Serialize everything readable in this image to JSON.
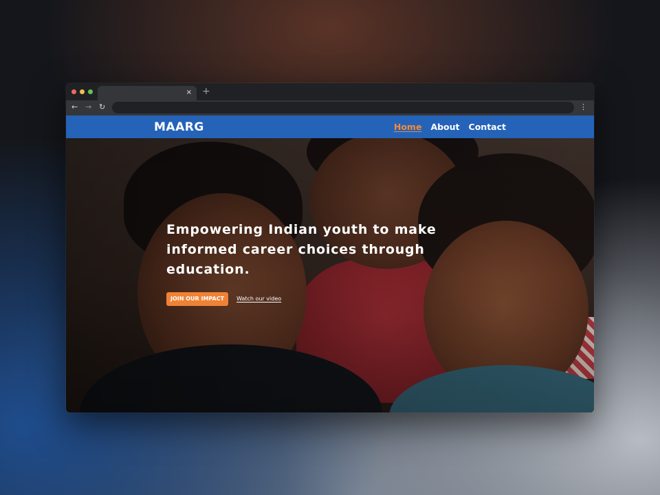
{
  "browser": {
    "tab_close_glyph": "×",
    "new_tab_glyph": "+",
    "back_glyph": "←",
    "forward_glyph": "→",
    "reload_glyph": "↻",
    "menu_glyph": "⋮",
    "traffic_light_colors": [
      "#ed6a5e",
      "#f4bf4f",
      "#61c554"
    ]
  },
  "site": {
    "brand": "MAARG",
    "brand_color": "#2463b8",
    "accent_color": "#f08236",
    "nav": [
      {
        "label": "Home",
        "active": true
      },
      {
        "label": "About",
        "active": false
      },
      {
        "label": "Contact",
        "active": false
      }
    ]
  },
  "hero": {
    "headline": "Empowering Indian youth to make informed career choices through education.",
    "primary_button": "JOIN OUR IMPACT",
    "secondary_link": "Watch our video"
  }
}
